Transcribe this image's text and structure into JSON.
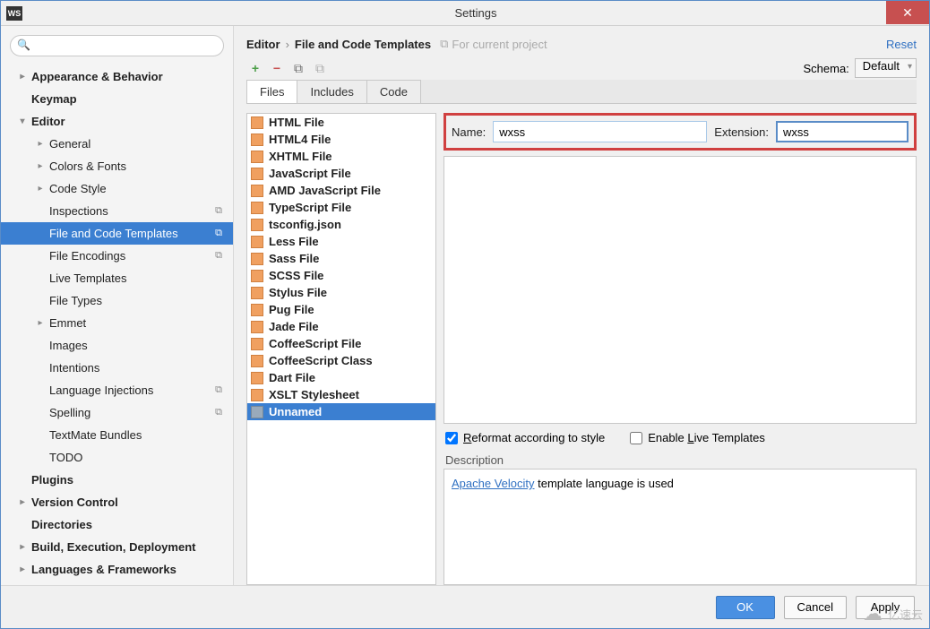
{
  "window": {
    "title": "Settings",
    "app_icon_label": "WS"
  },
  "sidebar": {
    "search_placeholder": "",
    "items": [
      {
        "label": "Appearance & Behavior",
        "bold": true,
        "chev": "▸",
        "lvl": 0
      },
      {
        "label": "Keymap",
        "bold": true,
        "chev": "",
        "lvl": 0
      },
      {
        "label": "Editor",
        "bold": true,
        "chev": "▾",
        "lvl": 0
      },
      {
        "label": "General",
        "chev": "▸",
        "lvl": 1
      },
      {
        "label": "Colors & Fonts",
        "chev": "▸",
        "lvl": 1
      },
      {
        "label": "Code Style",
        "chev": "▸",
        "lvl": 1
      },
      {
        "label": "Inspections",
        "chev": "",
        "lvl": 1,
        "proj": true
      },
      {
        "label": "File and Code Templates",
        "chev": "",
        "lvl": 1,
        "proj": true,
        "selected": true
      },
      {
        "label": "File Encodings",
        "chev": "",
        "lvl": 1,
        "proj": true
      },
      {
        "label": "Live Templates",
        "chev": "",
        "lvl": 1
      },
      {
        "label": "File Types",
        "chev": "",
        "lvl": 1
      },
      {
        "label": "Emmet",
        "chev": "▸",
        "lvl": 1
      },
      {
        "label": "Images",
        "chev": "",
        "lvl": 1
      },
      {
        "label": "Intentions",
        "chev": "",
        "lvl": 1
      },
      {
        "label": "Language Injections",
        "chev": "",
        "lvl": 1,
        "proj": true
      },
      {
        "label": "Spelling",
        "chev": "",
        "lvl": 1,
        "proj": true
      },
      {
        "label": "TextMate Bundles",
        "chev": "",
        "lvl": 1
      },
      {
        "label": "TODO",
        "chev": "",
        "lvl": 1
      },
      {
        "label": "Plugins",
        "bold": true,
        "chev": "",
        "lvl": 0
      },
      {
        "label": "Version Control",
        "bold": true,
        "chev": "▸",
        "lvl": 0
      },
      {
        "label": "Directories",
        "bold": true,
        "chev": "",
        "lvl": 0
      },
      {
        "label": "Build, Execution, Deployment",
        "bold": true,
        "chev": "▸",
        "lvl": 0
      },
      {
        "label": "Languages & Frameworks",
        "bold": true,
        "chev": "▸",
        "lvl": 0
      }
    ]
  },
  "breadcrumb": {
    "seg1": "Editor",
    "seg2": "File and Code Templates",
    "note": "For current project",
    "reset": "Reset"
  },
  "schema": {
    "label": "Schema:",
    "value": "Default"
  },
  "tabs": [
    {
      "label": "Files",
      "active": true
    },
    {
      "label": "Includes"
    },
    {
      "label": "Code"
    }
  ],
  "templates": [
    "HTML File",
    "HTML4 File",
    "XHTML File",
    "JavaScript File",
    "AMD JavaScript File",
    "TypeScript File",
    "tsconfig.json",
    "Less File",
    "Sass File",
    "SCSS File",
    "Stylus File",
    "Pug File",
    "Jade File",
    "CoffeeScript File",
    "CoffeeScript Class",
    "Dart File",
    "XSLT Stylesheet"
  ],
  "templates_selected": "Unnamed",
  "form": {
    "name_label": "Name:",
    "name_value": "wxss",
    "ext_label": "Extension:",
    "ext_value": "wxss"
  },
  "checks": {
    "reformat_label_pre": "R",
    "reformat_label_rest": "eformat according to style",
    "reformat_checked": true,
    "live_label_pre": "Enable ",
    "live_label_und": "L",
    "live_label_rest": "ive Templates",
    "live_checked": false
  },
  "desc": {
    "label": "Description",
    "link": "Apache Velocity",
    "rest": " template language is used"
  },
  "footer": {
    "ok": "OK",
    "cancel": "Cancel",
    "apply": "Apply"
  },
  "watermark": "亿速云"
}
